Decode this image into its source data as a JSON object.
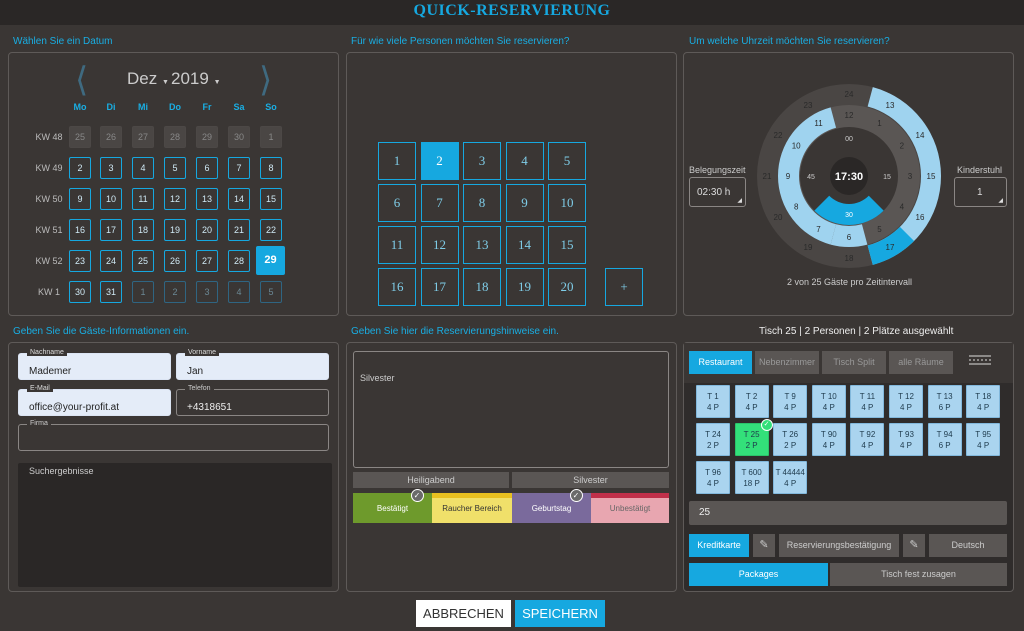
{
  "app": {
    "title": "QUICK-RESERVIERUNG"
  },
  "sections": {
    "date": "Wählen Sie ein Datum",
    "persons": "Für wie viele Personen möchten Sie reservieren?",
    "time": "Um welche Uhrzeit möchten Sie reservieren?",
    "guest": "Geben Sie die Gäste-Informationen ein.",
    "notes": "Geben Sie hier die Reservierungshinweise ein.",
    "table_summary": "Tisch 25 | 2 Personen | 2 Plätze ausgewählt"
  },
  "calendar": {
    "month": "Dez",
    "year": "2019",
    "weekdays": [
      "Mo",
      "Di",
      "Mi",
      "Do",
      "Fr",
      "Sa",
      "So"
    ],
    "weeks": [
      {
        "kw": "KW 48",
        "days": [
          "25",
          "26",
          "27",
          "28",
          "29",
          "30",
          "1"
        ],
        "state": [
          "dim",
          "dim",
          "dim",
          "dim",
          "dim",
          "dim",
          "dim"
        ]
      },
      {
        "kw": "KW 49",
        "days": [
          "2",
          "3",
          "4",
          "5",
          "6",
          "7",
          "8"
        ],
        "state": [
          "n",
          "n",
          "n",
          "n",
          "n",
          "n",
          "n"
        ]
      },
      {
        "kw": "KW 50",
        "days": [
          "9",
          "10",
          "11",
          "12",
          "13",
          "14",
          "15"
        ],
        "state": [
          "n",
          "n",
          "n",
          "n",
          "n",
          "n",
          "n"
        ]
      },
      {
        "kw": "KW 51",
        "days": [
          "16",
          "17",
          "18",
          "19",
          "20",
          "21",
          "22"
        ],
        "state": [
          "n",
          "n",
          "n",
          "n",
          "n",
          "n",
          "n"
        ]
      },
      {
        "kw": "KW 52",
        "days": [
          "23",
          "24",
          "25",
          "26",
          "27",
          "28",
          "29"
        ],
        "state": [
          "n",
          "n",
          "n",
          "n",
          "n",
          "n",
          "sel"
        ]
      },
      {
        "kw": "KW 1",
        "days": [
          "30",
          "31",
          "1",
          "2",
          "3",
          "4",
          "5"
        ],
        "state": [
          "n",
          "n",
          "out",
          "out",
          "out",
          "out",
          "out"
        ]
      }
    ]
  },
  "persons": {
    "options": [
      "1",
      "2",
      "3",
      "4",
      "5",
      "6",
      "7",
      "8",
      "9",
      "10",
      "11",
      "12",
      "13",
      "14",
      "15",
      "16",
      "17",
      "18",
      "19",
      "20"
    ],
    "selected": "2",
    "more": "+"
  },
  "time": {
    "duration_label": "Belegungszeit",
    "duration_value": "02:30 h",
    "child_label": "Kinderstuhl",
    "child_value": "1",
    "center": "17:30",
    "selected_minute": "30",
    "outer_hours": [
      "24",
      "13",
      "14",
      "15",
      "16",
      "17",
      "18",
      "19",
      "20",
      "21",
      "22",
      "23"
    ],
    "inner_hours": [
      "12",
      "1",
      "2",
      "3",
      "4",
      "5",
      "6",
      "7",
      "8",
      "9",
      "10",
      "11"
    ],
    "minutes": [
      "00",
      "15",
      "30",
      "45"
    ],
    "capacity": "2 von 25 Gäste pro Zeitintervall"
  },
  "guest": {
    "lastname_label": "Nachname",
    "lastname": "Mademer",
    "firstname_label": "Vorname",
    "firstname": "Jan",
    "email_label": "E-Mail",
    "email": "office@your-profit.at",
    "phone_label": "Telefon",
    "phone": "+4318651",
    "company_label": "Firma",
    "company": "",
    "results_label": "Suchergebnisse"
  },
  "notes": {
    "text": "Silvester",
    "chips": [
      "Heiligabend",
      "Silvester"
    ],
    "tags": [
      {
        "label": "Bestätigt",
        "color": "#6e9a2c",
        "text": "#fff",
        "checked": true
      },
      {
        "label": "Raucher Bereich",
        "color": "#f0e06a",
        "text": "#333",
        "bar": "#e8c020",
        "checked": false
      },
      {
        "label": "Geburtstag",
        "color": "#7a6a9c",
        "text": "#fff",
        "checked": true
      },
      {
        "label": "Unbestätigt",
        "color": "#e8a6b0",
        "text": "#666",
        "bar": "#c0304a",
        "checked": false
      }
    ]
  },
  "tables": {
    "tabs": [
      "Restaurant",
      "Nebenzimmer",
      "Tisch Split",
      "alle Räume"
    ],
    "active_tab": "Restaurant",
    "items": [
      {
        "name": "T 1",
        "seats": "4 P"
      },
      {
        "name": "T 2",
        "seats": "4 P"
      },
      {
        "name": "T 9",
        "seats": "4 P"
      },
      {
        "name": "T 10",
        "seats": "4 P"
      },
      {
        "name": "T 11",
        "seats": "4 P"
      },
      {
        "name": "T 12",
        "seats": "4 P"
      },
      {
        "name": "T 13",
        "seats": "6 P"
      },
      {
        "name": "T 18",
        "seats": "4 P"
      },
      {
        "name": "T 24",
        "seats": "2 P"
      },
      {
        "name": "T 25",
        "seats": "2 P",
        "active": true
      },
      {
        "name": "T 26",
        "seats": "2 P"
      },
      {
        "name": "T 90",
        "seats": "4 P"
      },
      {
        "name": "T 92",
        "seats": "4 P"
      },
      {
        "name": "T 93",
        "seats": "4 P"
      },
      {
        "name": "T 94",
        "seats": "6 P"
      },
      {
        "name": "T 95",
        "seats": "4 P"
      },
      {
        "name": "T 96",
        "seats": "4 P"
      },
      {
        "name": "T 600",
        "seats": "18 P"
      },
      {
        "name": "T 44444",
        "seats": "4 P"
      }
    ],
    "table_input": "25",
    "kredit": "Kreditkarte",
    "confirm": "Reservierungsbestätigung",
    "language": "Deutsch",
    "packages": "Packages",
    "fixed": "Tisch fest zusagen"
  },
  "footer": {
    "cancel": "ABBRECHEN",
    "save": "SPEICHERN"
  },
  "colors": {
    "accent": "#16a8e0",
    "bg": "#3a3634",
    "topbar": "#2a2726"
  }
}
